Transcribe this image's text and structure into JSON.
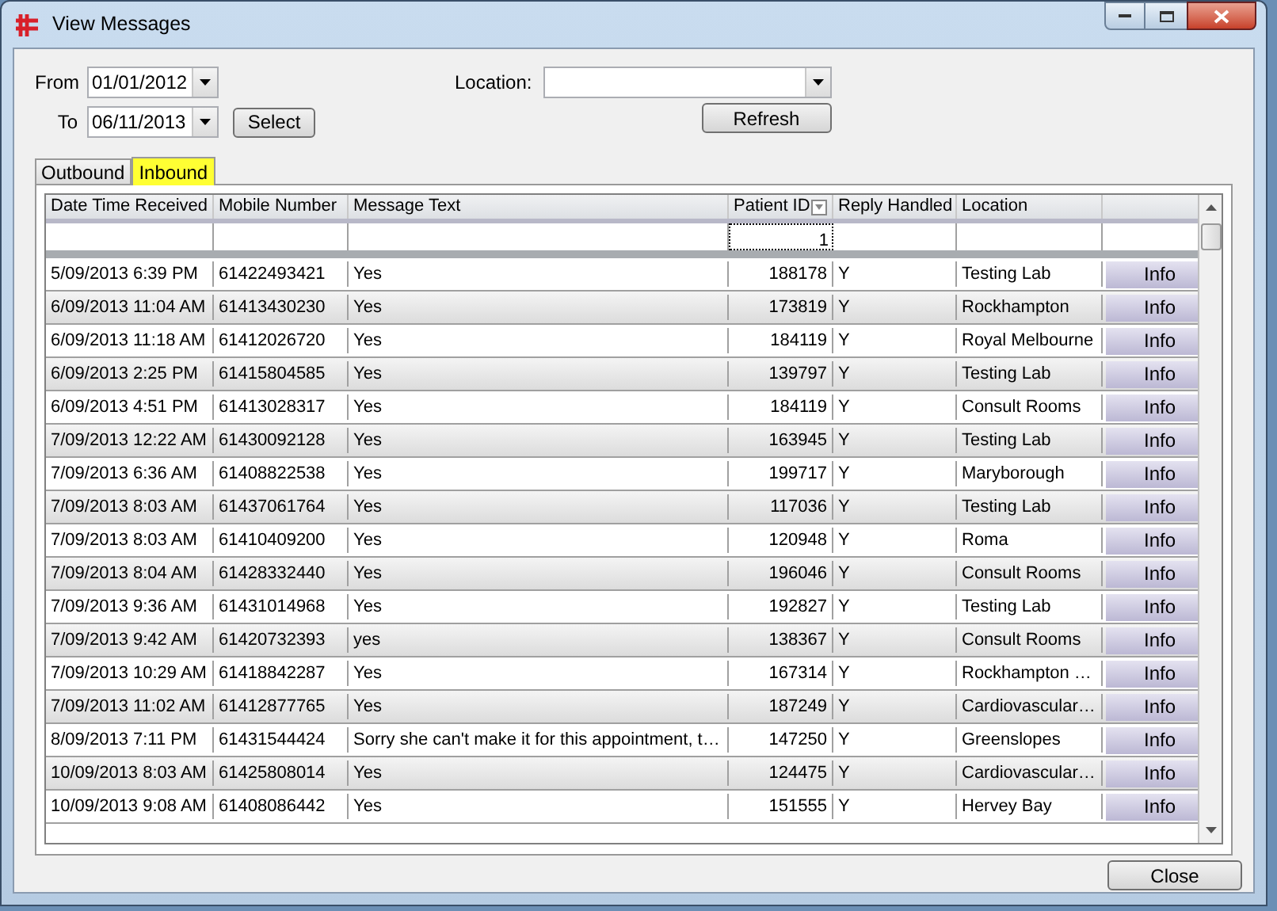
{
  "window": {
    "title": "View Messages"
  },
  "filters": {
    "from_label": "From",
    "from_value": "01/01/2012",
    "to_label": "To",
    "to_value": "06/11/2013",
    "select_button": "Select",
    "location_label": "Location:",
    "refresh_button": "Refresh"
  },
  "tabs": [
    {
      "label": "Outbound",
      "selected": false
    },
    {
      "label": "Inbound",
      "selected": true
    }
  ],
  "table": {
    "columns": [
      "Date Time Received",
      "Mobile Number",
      "Message Text",
      "Patient ID",
      "Reply Handled",
      "Location"
    ],
    "filter_values": {
      "patient_id": "1"
    },
    "rows": [
      {
        "received": "5/09/2013 6:39 PM",
        "mobile": "61422493421",
        "message": "Yes",
        "patient_id": "188178",
        "reply": "Y",
        "location": "Testing Lab",
        "action": "Info"
      },
      {
        "received": "6/09/2013 11:04 AM",
        "mobile": "61413430230",
        "message": "Yes",
        "patient_id": "173819",
        "reply": "Y",
        "location": "Rockhampton",
        "action": "Info"
      },
      {
        "received": "6/09/2013 11:18 AM",
        "mobile": "61412026720",
        "message": "Yes",
        "patient_id": "184119",
        "reply": "Y",
        "location": "Royal Melbourne",
        "action": "Info"
      },
      {
        "received": "6/09/2013 2:25 PM",
        "mobile": "61415804585",
        "message": "Yes",
        "patient_id": "139797",
        "reply": "Y",
        "location": "Testing Lab",
        "action": "Info"
      },
      {
        "received": "6/09/2013 4:51 PM",
        "mobile": "61413028317",
        "message": "Yes",
        "patient_id": "184119",
        "reply": "Y",
        "location": "Consult Rooms",
        "action": "Info"
      },
      {
        "received": "7/09/2013 12:22 AM",
        "mobile": "61430092128",
        "message": "Yes",
        "patient_id": "163945",
        "reply": "Y",
        "location": "Testing Lab",
        "action": "Info"
      },
      {
        "received": "7/09/2013 6:36 AM",
        "mobile": "61408822538",
        "message": "Yes",
        "patient_id": "199717",
        "reply": "Y",
        "location": "Maryborough",
        "action": "Info"
      },
      {
        "received": "7/09/2013 8:03 AM",
        "mobile": "61437061764",
        "message": "Yes",
        "patient_id": "117036",
        "reply": "Y",
        "location": "Testing Lab",
        "action": "Info"
      },
      {
        "received": "7/09/2013 8:03 AM",
        "mobile": "61410409200",
        "message": "Yes",
        "patient_id": "120948",
        "reply": "Y",
        "location": "Roma",
        "action": "Info"
      },
      {
        "received": "7/09/2013 8:04 AM",
        "mobile": "61428332440",
        "message": "Yes",
        "patient_id": "196046",
        "reply": "Y",
        "location": "Consult Rooms",
        "action": "Info"
      },
      {
        "received": "7/09/2013 9:36 AM",
        "mobile": "61431014968",
        "message": "Yes",
        "patient_id": "192827",
        "reply": "Y",
        "location": "Testing Lab",
        "action": "Info"
      },
      {
        "received": "7/09/2013 9:42 AM",
        "mobile": "61420732393",
        "message": "yes",
        "patient_id": "138367",
        "reply": "Y",
        "location": "Consult Rooms",
        "action": "Info"
      },
      {
        "received": "7/09/2013 10:29 AM",
        "mobile": "61418842287",
        "message": "Yes",
        "patient_id": "167314",
        "reply": "Y",
        "location": "Rockhampton …",
        "action": "Info"
      },
      {
        "received": "7/09/2013 11:02 AM",
        "mobile": "61412877765",
        "message": "Yes",
        "patient_id": "187249",
        "reply": "Y",
        "location": "Cardiovascular…",
        "action": "Info"
      },
      {
        "received": "8/09/2013 7:11 PM",
        "mobile": "61431544424",
        "message": "Sorry she can't make it for this appointment, t…",
        "patient_id": "147250",
        "reply": "Y",
        "location": "Greenslopes",
        "action": "Info"
      },
      {
        "received": "10/09/2013 8:03 AM",
        "mobile": "61425808014",
        "message": "Yes",
        "patient_id": "124475",
        "reply": "Y",
        "location": "Cardiovascular…",
        "action": "Info"
      },
      {
        "received": "10/09/2013 9:08 AM",
        "mobile": "61408086442",
        "message": "Yes",
        "patient_id": "151555",
        "reply": "Y",
        "location": "Hervey Bay",
        "action": "Info"
      }
    ]
  },
  "close_button": "Close"
}
